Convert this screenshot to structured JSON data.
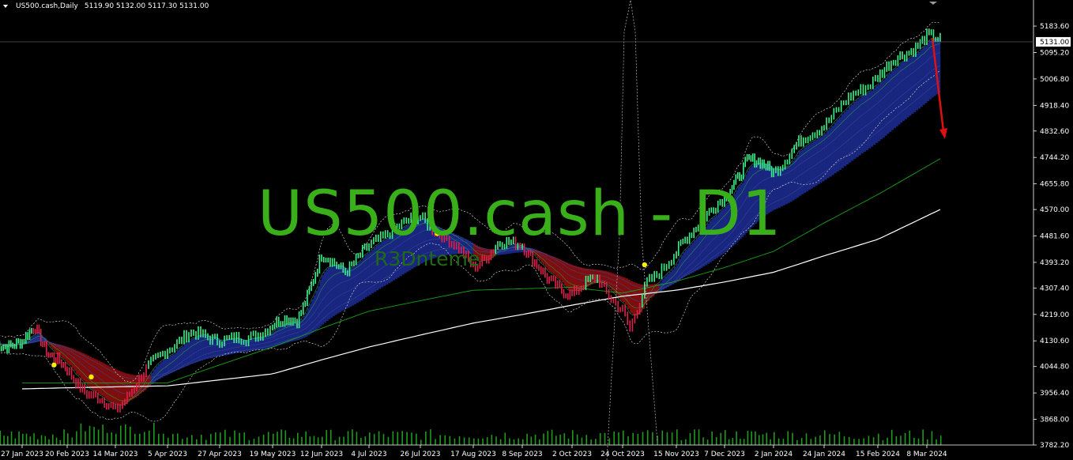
{
  "header": {
    "symbol": "US500.cash,Daily",
    "ohlc": "5119.90 5132.00 5117.30 5131.00"
  },
  "watermark": {
    "title": "US500.cash - D1",
    "subtitle": "R3Dnteme"
  },
  "current_price": "5131.00",
  "colors": {
    "background": "#000000",
    "candles_up": "#3cf08a",
    "candles_down": "#e0204a",
    "ribbon_bull": "#1c2a8c",
    "ribbon_bear": "#8a1010",
    "ma_long_green": "#1aa01a",
    "ma_long_white": "#ffffff",
    "volume": "#1f9a1f",
    "arrow": "#e01010",
    "dots": "#ffee00"
  },
  "chart_data": {
    "type": "line",
    "title": "US500.cash,Daily",
    "xlabel": "",
    "ylabel": "",
    "ylim": [
      3782.2,
      5226.0
    ],
    "grid": false,
    "y_ticks": [
      "5183.60",
      "5095.20",
      "5006.80",
      "4918.40",
      "4832.60",
      "4744.20",
      "4655.80",
      "4570.00",
      "4481.60",
      "4393.20",
      "4307.40",
      "4219.00",
      "4130.60",
      "4044.80",
      "3956.40",
      "3868.00",
      "3782.20"
    ],
    "x_ticks": [
      "27 Jan 2023",
      "20 Feb 2023",
      "14 Mar 2023",
      "5 Apr 2023",
      "27 Apr 2023",
      "19 May 2023",
      "12 Jun 2023",
      "4 Jul 2023",
      "26 Jul 2023",
      "17 Aug 2023",
      "8 Sep 2023",
      "2 Oct 2023",
      "24 Oct 2023",
      "15 Nov 2023",
      "7 Dec 2023",
      "2 Jan 2024",
      "24 Jan 2024",
      "15 Feb 2024",
      "8 Mar 2024"
    ],
    "series": [
      {
        "name": "US500.cash",
        "x": [
          "27 Jan 2023",
          "3 Feb 2023",
          "10 Feb 2023",
          "20 Feb 2023",
          "1 Mar 2023",
          "9 Mar 2023",
          "14 Mar 2023",
          "23 Mar 2023",
          "5 Apr 2023",
          "14 Apr 2023",
          "27 Apr 2023",
          "8 May 2023",
          "19 May 2023",
          "31 May 2023",
          "12 Jun 2023",
          "23 Jun 2023",
          "4 Jul 2023",
          "14 Jul 2023",
          "26 Jul 2023",
          "4 Aug 2023",
          "17 Aug 2023",
          "28 Aug 2023",
          "8 Sep 2023",
          "20 Sep 2023",
          "2 Oct 2023",
          "13 Oct 2023",
          "24 Oct 2023",
          "27 Oct 2023",
          "3 Nov 2023",
          "15 Nov 2023",
          "27 Nov 2023",
          "7 Dec 2023",
          "19 Dec 2023",
          "2 Jan 2024",
          "12 Jan 2024",
          "24 Jan 2024",
          "5 Feb 2024",
          "15 Feb 2024",
          "27 Feb 2024",
          "8 Mar 2024",
          "14 Mar 2024"
        ],
        "y": [
          4120,
          4180,
          4090,
          4030,
          3960,
          3920,
          3900,
          3990,
          4110,
          4150,
          4140,
          4130,
          4190,
          4200,
          4410,
          4370,
          4440,
          4510,
          4540,
          4490,
          4380,
          4450,
          4460,
          4330,
          4290,
          4340,
          4230,
          4160,
          4330,
          4420,
          4550,
          4600,
          4740,
          4700,
          4780,
          4860,
          4950,
          5020,
          5090,
          5150,
          5131
        ]
      },
      {
        "name": "",
        "x": [
          "27 Jan 2023",
          "5 Apr 2023",
          "19 May 2023",
          "4 Jul 2023",
          "17 Aug 2023",
          "2 Oct 2023",
          "24 Oct 2023",
          "15 Nov 2023",
          "2 Jan 2024",
          "15 Feb 2024",
          "14 Mar 2024"
        ],
        "y": [
          3990,
          3990,
          4110,
          4230,
          4300,
          4310,
          4290,
          4330,
          4430,
          4620,
          4740
        ]
      },
      {
        "name": "",
        "x": [
          "27 Jan 2023",
          "5 Apr 2023",
          "19 May 2023",
          "4 Jul 2023",
          "17 Aug 2023",
          "2 Oct 2023",
          "24 Oct 2023",
          "15 Nov 2023",
          "2 Jan 2024",
          "15 Feb 2024",
          "14 Mar 2024"
        ],
        "y": [
          3970,
          3980,
          4020,
          4110,
          4190,
          4250,
          4280,
          4300,
          4360,
          4470,
          4570
        ]
      }
    ],
    "annotations": [
      "Red down arrow after last bar"
    ]
  }
}
